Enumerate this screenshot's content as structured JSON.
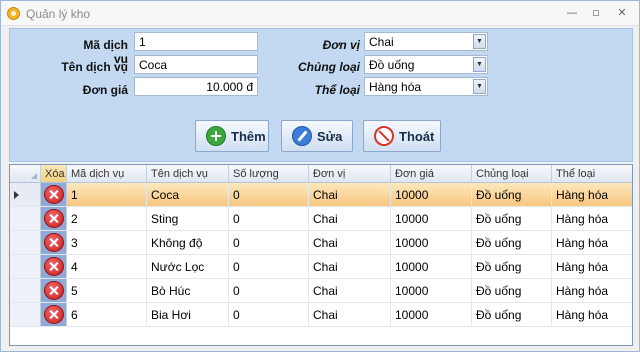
{
  "window": {
    "title": "Quản lý kho",
    "minimize": "—",
    "maximize": "▫",
    "close": "✕"
  },
  "form": {
    "ma_label": "Mã dịch vụ",
    "ma_value": "1",
    "ten_label": "Tên dịch vụ",
    "ten_value": "Coca",
    "gia_label": "Đơn giá",
    "gia_value": "10.000 đ",
    "donvi_label": "Đơn vị",
    "donvi_value": "Chai",
    "chungloai_label": "Chủng loại",
    "chungloai_value": "Đồ uống",
    "theloai_label": "Thể loại",
    "theloai_value": "Hàng hóa"
  },
  "buttons": {
    "add": "Thêm",
    "edit": "Sửa",
    "exit": "Thoát"
  },
  "grid": {
    "columns": [
      "Xóa",
      "Mã dịch vụ",
      "Tên dịch vụ",
      "Số lượng",
      "Đơn vị",
      "Đơn giá",
      "Chủng loại",
      "Thể loại"
    ],
    "rows": [
      [
        "1",
        "Coca",
        "0",
        "Chai",
        "10000",
        "Đồ uống",
        "Hàng hóa"
      ],
      [
        "2",
        "Sting",
        "0",
        "Chai",
        "10000",
        "Đồ uống",
        "Hàng hóa"
      ],
      [
        "3",
        "Không độ",
        "0",
        "Chai",
        "10000",
        "Đồ uống",
        "Hàng hóa"
      ],
      [
        "4",
        "Nước Lọc",
        "0",
        "Chai",
        "10000",
        "Đồ uống",
        "Hàng hóa"
      ],
      [
        "5",
        "Bò Húc",
        "0",
        "Chai",
        "10000",
        "Đồ uống",
        "Hàng hóa"
      ],
      [
        "6",
        "Bia Hơi",
        "0",
        "Chai",
        "10000",
        "Đồ uống",
        "Hàng hóa"
      ]
    ],
    "selected_row": 0
  },
  "colors": {
    "panel": "#c3d8f1",
    "selected_row": "#f8c680",
    "delete_icon": "#c81d1d"
  }
}
